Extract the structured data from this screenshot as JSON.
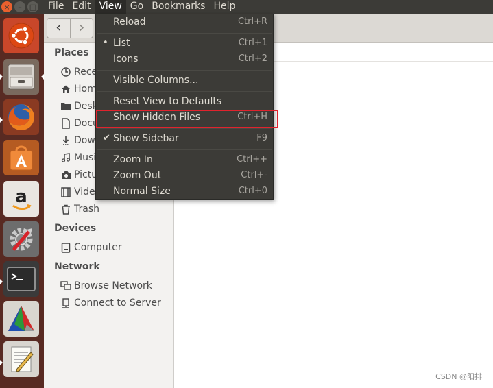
{
  "menubar": {
    "menus": [
      "File",
      "Edit",
      "View",
      "Go",
      "Bookmarks",
      "Help"
    ],
    "active_menu": "View"
  },
  "window_controls": {
    "close_glyph": "×",
    "minimize_glyph": "–",
    "maximize_glyph": "□"
  },
  "launcher": {
    "items": [
      {
        "name": "ubuntu-dash-icon"
      },
      {
        "name": "files-icon"
      },
      {
        "name": "firefox-icon"
      },
      {
        "name": "software-center-icon"
      },
      {
        "name": "amazon-icon"
      },
      {
        "name": "system-settings-icon"
      },
      {
        "name": "terminal-icon"
      },
      {
        "name": "cmake-icon"
      },
      {
        "name": "text-editor-icon"
      }
    ]
  },
  "toolbar": {
    "back_glyph": "‹",
    "forward_glyph": "›"
  },
  "sidebar": {
    "places_heading": "Places",
    "places": [
      {
        "label": "Rece",
        "icon": "recent-icon"
      },
      {
        "label": "Hom",
        "icon": "home-icon"
      },
      {
        "label": "Desk",
        "icon": "desktop-icon"
      },
      {
        "label": "Docu",
        "icon": "documents-icon"
      },
      {
        "label": "Dowi",
        "icon": "downloads-icon"
      },
      {
        "label": "Musi",
        "icon": "music-icon"
      },
      {
        "label": "Pictu",
        "icon": "pictures-icon"
      },
      {
        "label": "Vide",
        "icon": "videos-icon"
      },
      {
        "label": "Trash",
        "icon": "trash-icon"
      }
    ],
    "devices_heading": "Devices",
    "devices": [
      {
        "label": "Computer",
        "icon": "drive-icon"
      }
    ],
    "network_heading": "Network",
    "network": [
      {
        "label": "Browse Network",
        "icon": "network-icon"
      },
      {
        "label": "Connect to Server",
        "icon": "server-icon"
      }
    ]
  },
  "view_menu": {
    "reload": {
      "label": "Reload",
      "shortcut": "Ctrl+R"
    },
    "list": {
      "label": "List",
      "shortcut": "Ctrl+1",
      "mark": "•"
    },
    "icons": {
      "label": "Icons",
      "shortcut": "Ctrl+2"
    },
    "visible_columns": {
      "label": "Visible Columns..."
    },
    "reset_view": {
      "label": "Reset View to Defaults"
    },
    "show_hidden": {
      "label": "Show Hidden Files",
      "shortcut": "Ctrl+H"
    },
    "show_sidebar": {
      "label": "Show Sidebar",
      "shortcut": "F9",
      "mark": "✔"
    },
    "zoom_in": {
      "label": "Zoom In",
      "shortcut": "Ctrl++"
    },
    "zoom_out": {
      "label": "Zoom Out",
      "shortcut": "Ctrl+-"
    },
    "normal_size": {
      "label": "Normal Size",
      "shortcut": "Ctrl+0"
    }
  },
  "watermark": "CSDN @阳排",
  "colors": {
    "menubar_bg": "#3c3b37",
    "launcher_bg": "#582a22",
    "highlight_border": "#e0232d",
    "sidebar_bg": "#f3f2f0"
  }
}
